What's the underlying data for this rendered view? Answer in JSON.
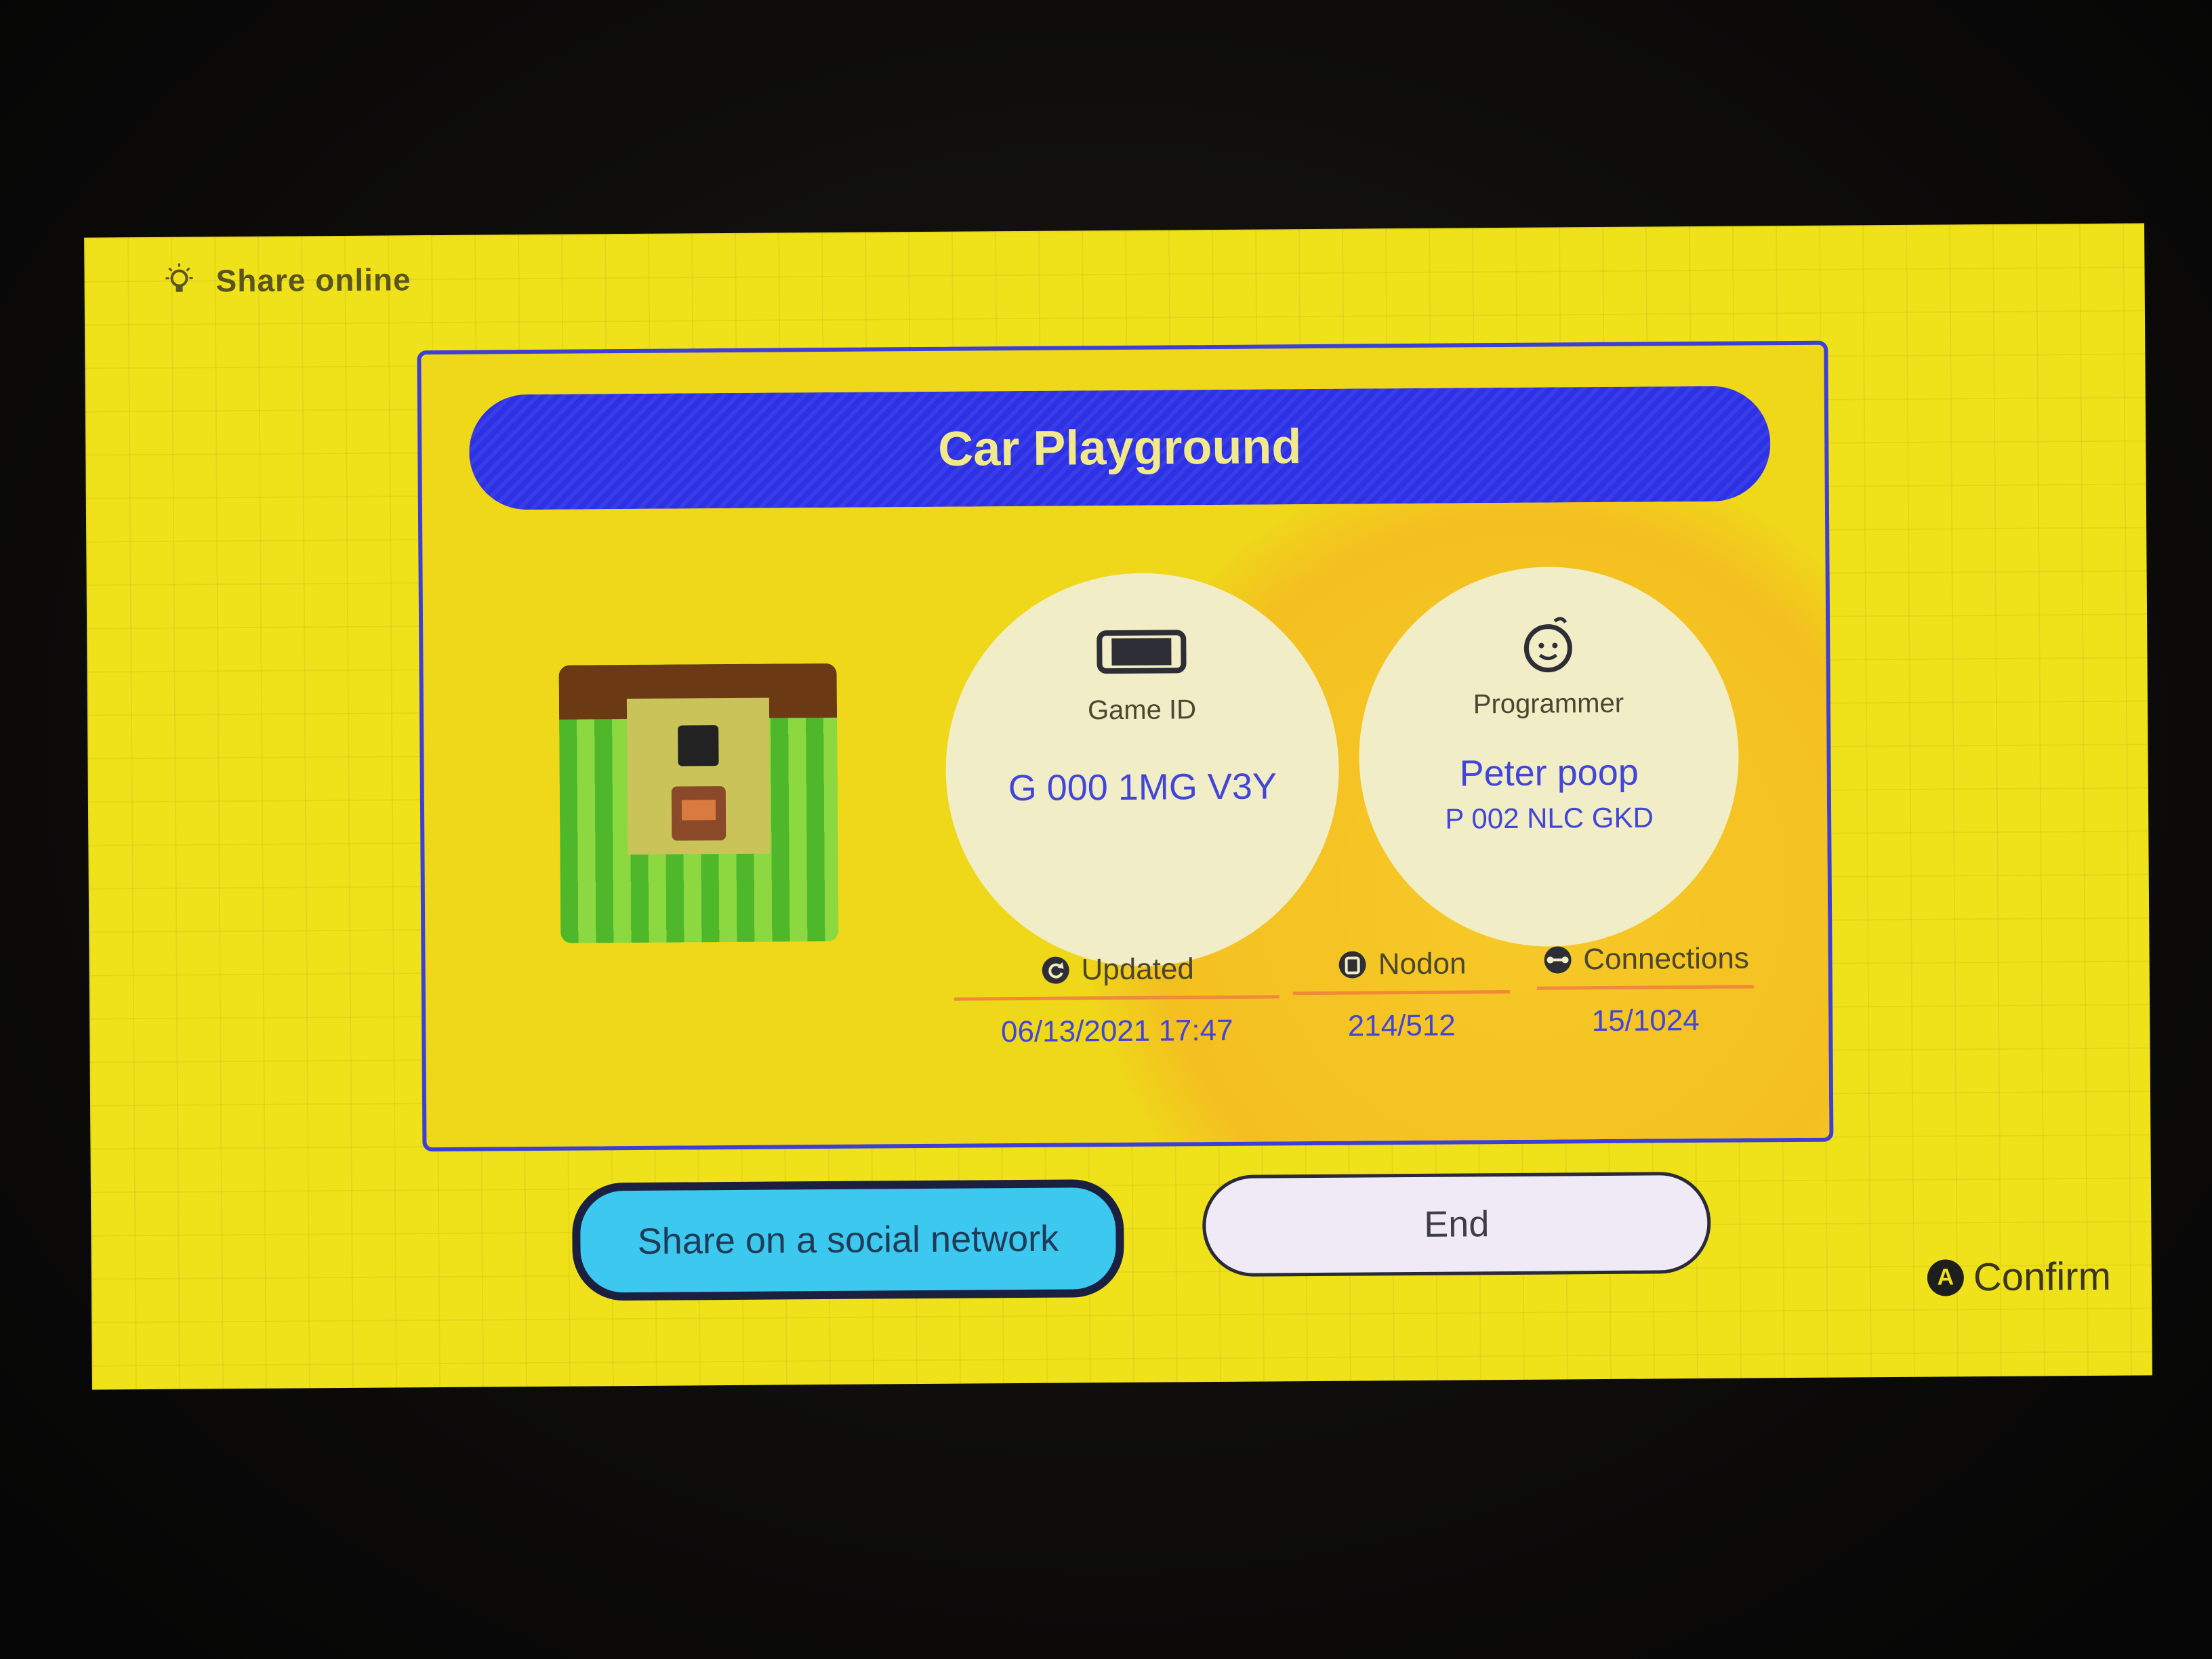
{
  "header": {
    "title": "Share online",
    "icon": "lightbulb-icon"
  },
  "game": {
    "title": "Car Playground",
    "game_id_label": "Game ID",
    "game_id": "G 000 1MG V3Y",
    "programmer_label": "Programmer",
    "programmer_name": "Peter poop",
    "programmer_id": "P 002 NLC GKD"
  },
  "stats": {
    "updated_label": "Updated",
    "updated_value": "06/13/2021 17:47",
    "nodon_label": "Nodon",
    "nodon_value": "214/512",
    "connections_label": "Connections",
    "connections_value": "15/1024"
  },
  "buttons": {
    "share_label": "Share on a social network",
    "end_label": "End"
  },
  "footer": {
    "confirm_button_glyph": "A",
    "confirm_label": "Confirm"
  },
  "colors": {
    "background": "#f0e21a",
    "title_bar": "#2d31e6",
    "accent_text": "#4246d8",
    "share_button": "#3cc8ef"
  }
}
